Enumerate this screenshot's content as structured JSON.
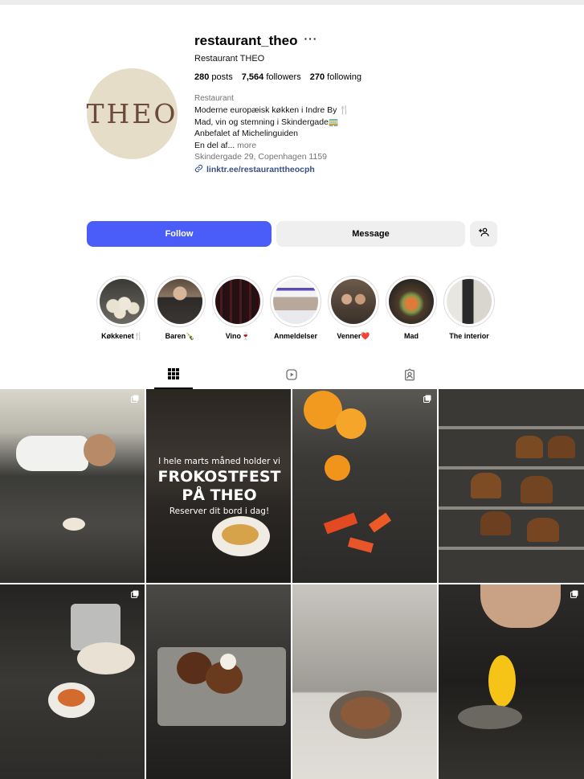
{
  "profile": {
    "username": "restaurant_theo",
    "more_glyph": "···",
    "full_name": "Restaurant THEO",
    "avatar_text": "THEO",
    "stats": {
      "posts_count": "280",
      "posts_label": "posts",
      "followers_count": "7,564",
      "followers_label": "followers",
      "following_count": "270",
      "following_label": "following"
    },
    "category": "Restaurant",
    "bio_lines": [
      "Moderne europæisk køkken i Indre By 🍴",
      "Mad, vin og stemning i Skindergade🚃",
      "Anbefalet af Michelinguiden",
      "En del af..."
    ],
    "bio_more": "more",
    "address": "Skindergade 29, Copenhagen 1159",
    "link": "linktr.ee/restauranttheocph"
  },
  "actions": {
    "follow_label": "Follow",
    "message_label": "Message",
    "add_user_icon": "add-user-icon"
  },
  "highlights": [
    {
      "label": "Køkkenet🍴",
      "icon": "highlight-kitchen"
    },
    {
      "label": "Baren🍾",
      "icon": "highlight-bar"
    },
    {
      "label": "Vino🍷",
      "icon": "highlight-wine"
    },
    {
      "label": "Anmeldelser",
      "icon": "highlight-reviews"
    },
    {
      "label": "Venner❤️",
      "icon": "highlight-friends"
    },
    {
      "label": "Mad",
      "icon": "highlight-food"
    },
    {
      "label": "The interior",
      "icon": "highlight-interior"
    }
  ],
  "tabs": [
    {
      "name": "posts",
      "icon": "grid-icon",
      "active": true
    },
    {
      "name": "reels",
      "icon": "reels-icon",
      "active": false
    },
    {
      "name": "tagged",
      "icon": "tagged-icon",
      "active": false
    }
  ],
  "posts": [
    {
      "subject": "chef plating at counter",
      "multi": true
    },
    {
      "subject": "frokostfest promo",
      "multi": false,
      "overlay": {
        "line1": "I hele marts måned holder vi",
        "line2": "FROKOSTFEST",
        "line3": "PÅ THEO",
        "line4": "Reserver dit bord i dag!"
      }
    },
    {
      "subject": "peppers and oranges",
      "multi": true
    },
    {
      "subject": "muffins on rack",
      "multi": false
    },
    {
      "subject": "pouring sauce",
      "multi": true
    },
    {
      "subject": "fried dish with tongs",
      "multi": false
    },
    {
      "subject": "dessert bowl",
      "multi": false
    },
    {
      "subject": "piping mango dessert",
      "multi": true
    }
  ],
  "colors": {
    "follow_blue": "#4a5df9",
    "link_blue": "#385185",
    "avatar_bg": "#e6ddc8",
    "avatar_text": "#6b4a3a"
  }
}
